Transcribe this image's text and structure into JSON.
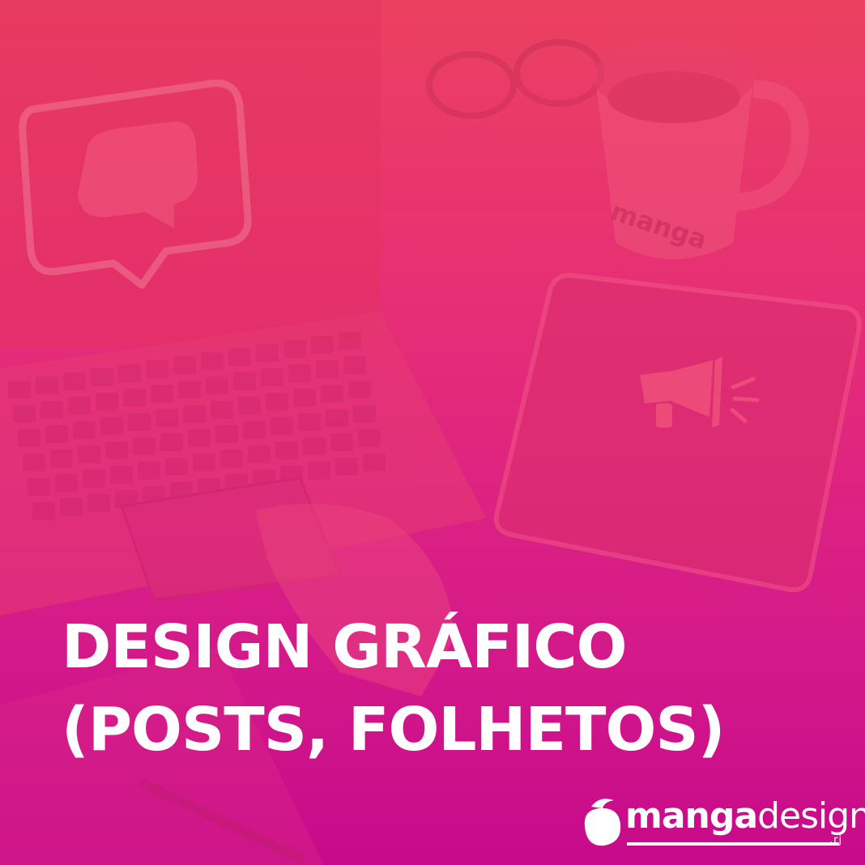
{
  "headline": {
    "line1": "DESIGN GRÁFICO",
    "line2": "(POSTS, FOLHETOS)"
  },
  "logo": {
    "word_bold": "manga",
    "word_light": "design",
    "suffix": ".rj"
  },
  "mug_print": "manga",
  "icons": [
    "chat-bubble-icon",
    "megaphone-icon",
    "mango-logo-icon"
  ],
  "colors": {
    "gradient_top": "#ec4160",
    "gradient_bottom": "#c70a8a",
    "text": "#ffffff"
  }
}
